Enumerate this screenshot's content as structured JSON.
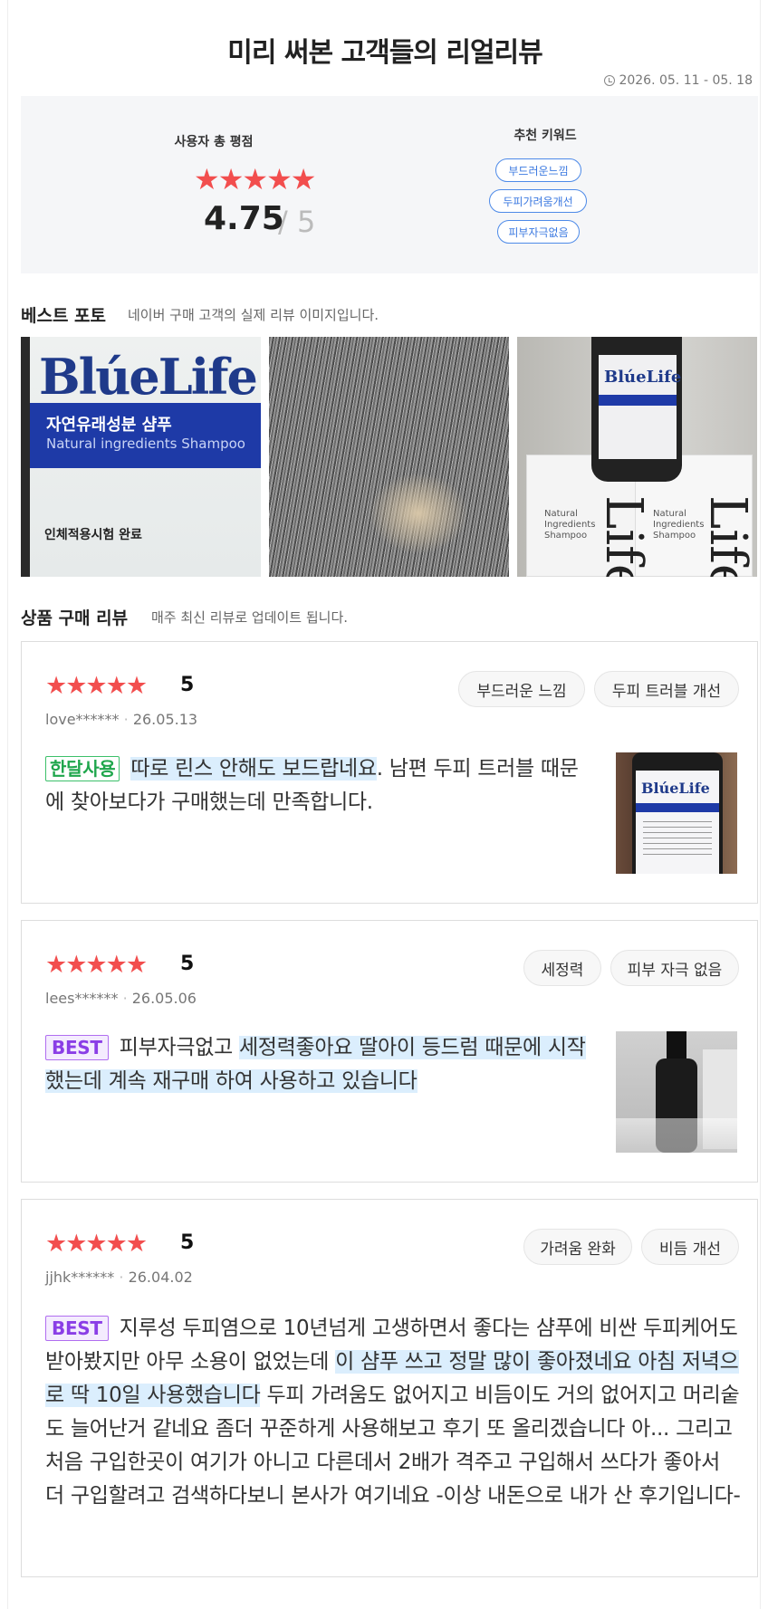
{
  "header": {
    "title": "미리 써본 고객들의 리얼리뷰",
    "period": "2026. 05. 11 - 05. 18"
  },
  "summary": {
    "rating_label": "사용자 총 평점",
    "stars": "★★★★★",
    "score": "4.75",
    "max": "/ 5",
    "rating_value": 4.75,
    "keywords_label": "추천 키워드",
    "keywords": [
      "부드러운느낌",
      "두피가려움개선",
      "피부자극없음"
    ]
  },
  "best_photo": {
    "title": "베스트 포토",
    "subtitle": "네이버 구매 고객의 실제 리뷰 이미지입니다.",
    "photo1": {
      "brand": "BlúeLife",
      "product_ko": "자연유래성분 샴푸",
      "product_en": "Natural ingredients Shampoo",
      "note": "인체적용시험 완료"
    },
    "photo3": {
      "brand": "BlúeLife",
      "box_text": "Natural Ingredients Shampoo",
      "box_logo": "Life"
    }
  },
  "reviews_section": {
    "title": "상품 구매 리뷰",
    "subtitle": "매주 최신 리뷰로 업데이트 됩니다."
  },
  "reviews": [
    {
      "stars": "★★★★★",
      "rating": "5",
      "user": "love******",
      "date": "26.05.13",
      "tags": [
        "부드러운 느낌",
        "두피 트러블 개선"
      ],
      "badge": "한달사용",
      "text_hl": "따로 린스 안해도 보드랍네요",
      "text_rest": ". 남편 두피 트러블 때문에 찾아보다가 구매했는데 만족합니다.",
      "thumb_brand": "BlúeLife"
    },
    {
      "stars": "★★★★★",
      "rating": "5",
      "user": "lees******",
      "date": "26.05.06",
      "tags": [
        "세정력",
        "피부 자극 없음"
      ],
      "badge": "BEST",
      "text_pre": "피부자극없고 ",
      "text_hl": "세정력좋아요 딸아이 등드럼 때문에 시작했는데 계속 재구매 하여 사용하고 있습니다"
    },
    {
      "stars": "★★★★★",
      "rating": "5",
      "user": "jjhk******",
      "date": "26.04.02",
      "tags": [
        "가려움 완화",
        "비듬 개선"
      ],
      "badge": "BEST",
      "text_pre": "지루성 두피염으로 10년넘게 고생하면서 좋다는 샴푸에 비싼 두피케어도 받아봤지만 아무 소용이 없었는데 ",
      "text_hl": "이 샴푸 쓰고 정말 많이 좋아졌네요 아침 저녁으로 딱 10일 사용했습니다",
      "text_rest": " 두피 가려움도 없어지고 비듬이도 거의 없어지고 머리숱도 늘어난거 같네요 좀더 꾸준하게 사용해보고 후기 또 올리겠습니다 아... 그리고 처음 구입한곳이 여기가 아니고 다른데서 2배가 격주고 구입해서 쓰다가 좋아서 더 구입할려고 검색하다보니 본사가 여기네요 -이상 내돈으로 내가 산 후기입니다-"
    }
  ],
  "colors": {
    "star": "#f24e4e",
    "keyword": "#3a78e0",
    "highlight": "#dbeefd",
    "badge_green": "#1fa64c",
    "badge_purple": "#8a3ee6"
  }
}
